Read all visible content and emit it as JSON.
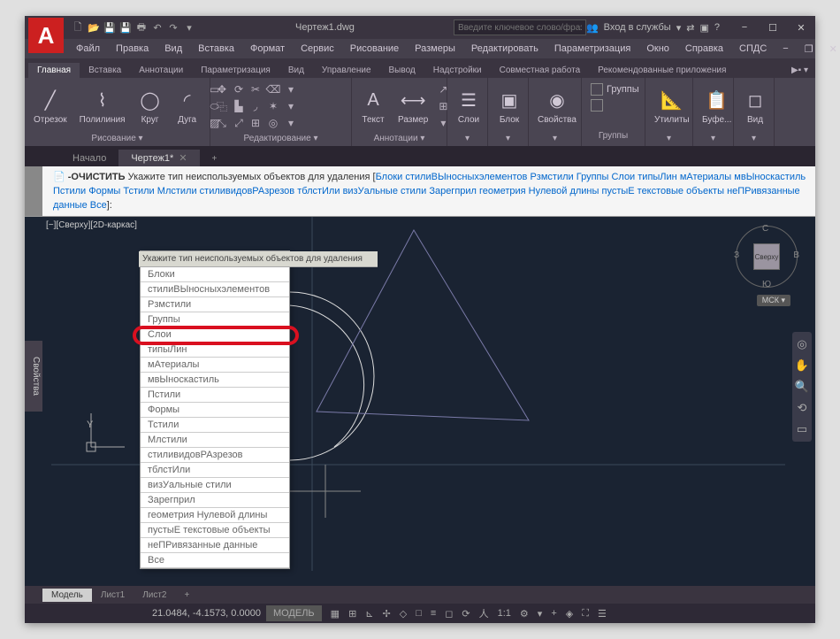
{
  "title": "Чертеж1.dwg",
  "search_placeholder": "Введите ключевое слово/фразу",
  "signin": "Вход в службы",
  "menu": {
    "file": "Файл",
    "edit": "Правка",
    "view": "Вид",
    "insert": "Вставка",
    "format": "Формат",
    "tools": "Сервис",
    "draw": "Рисование",
    "dim": "Размеры",
    "modify": "Редактировать",
    "param": "Параметризация",
    "window": "Окно",
    "help": "Справка",
    "spds": "СПДС"
  },
  "tabs": {
    "home": "Главная",
    "insert": "Вставка",
    "annotate": "Аннотации",
    "param": "Параметризация",
    "view": "Вид",
    "manage": "Управление",
    "output": "Вывод",
    "addins": "Надстройки",
    "collab": "Совместная работа",
    "featured": "Рекомендованные приложения"
  },
  "panel": {
    "draw": "Рисование ▾",
    "modify": "Редактирование ▾",
    "annot": "Аннотации ▾",
    "layers_lbl": "Слои",
    "block_lbl": "Блок",
    "props_lbl": "Свойства",
    "groups_lbl": "Группы",
    "util_lbl": "Утилиты",
    "clip_lbl": "Буфер",
    "view_lbl": "Вид"
  },
  "btn": {
    "line": "Отрезок",
    "pline": "Полилиния",
    "circle": "Круг",
    "arc": "Дуга",
    "text": "Текст",
    "dim": "Размер",
    "layers": "Слои",
    "block": "Блок",
    "props": "Свойства",
    "groups": "Группы",
    "util": "Утилиты",
    "clip": "Буфе...",
    "view": "Вид"
  },
  "doctabs": {
    "start": "Начало",
    "d1": "Чертеж1*"
  },
  "cmd": {
    "prefix": "-ОЧИСТИТЬ",
    "text1": "Укажите тип неиспользуемых объектов для удаления [",
    "blocks": "Блоки",
    "dstyles": "стилиВЫносныхэлементов",
    "dimst": "Рзмстили",
    "grp": "Группы",
    "lay": "Слои",
    "lt": "типыЛин",
    "mat": "мАтериалы",
    "mls": "мвЫноскастиль",
    "pst": "Пстили",
    "shp": "Формы",
    "tst": "Тстили",
    "mst": "Млстили",
    "vst": "стиливидовРАзрезов",
    "tblst": "тблстИли",
    "visst": "визУальные стили",
    "reg": "Зарегприл",
    "geo": "геометрия",
    "zero": "Нулевой длины",
    "emp": "пустыЕ текстовые объекты",
    "orph": "неПРивязанные данные",
    "all": "Все",
    "end": "]:"
  },
  "vp": "[−][Сверху][2D-каркас]",
  "sideprop": "Свойства",
  "cube": {
    "top": "Сверху",
    "n": "С",
    "s": "Ю",
    "e": "В",
    "w": "З",
    "mcs": "МСК ▾"
  },
  "popup": {
    "title": "Укажите тип неиспользуемых объектов для удаления",
    "items": [
      "Блоки",
      "стилиВЫносныхэлементов",
      "Рзмстили",
      "Группы",
      "Слои",
      "типыЛин",
      "мАтериалы",
      "мвЫноскастиль",
      "Пстили",
      "Формы",
      "Тстили",
      "Млстили",
      "стиливидовРАзрезов",
      "тблстИли",
      "визУальные стили",
      "Зарегприл",
      "геометрия Нулевой длины",
      "пустыЕ текстовые объекты",
      "неПРивязанные данные",
      "Все"
    ]
  },
  "layout": {
    "model": "Модель",
    "l1": "Лист1",
    "l2": "Лист2"
  },
  "status": {
    "coords": "21.0484, -4.1573, 0.0000",
    "model": "МОДЕЛЬ",
    "scale": "1:1"
  }
}
